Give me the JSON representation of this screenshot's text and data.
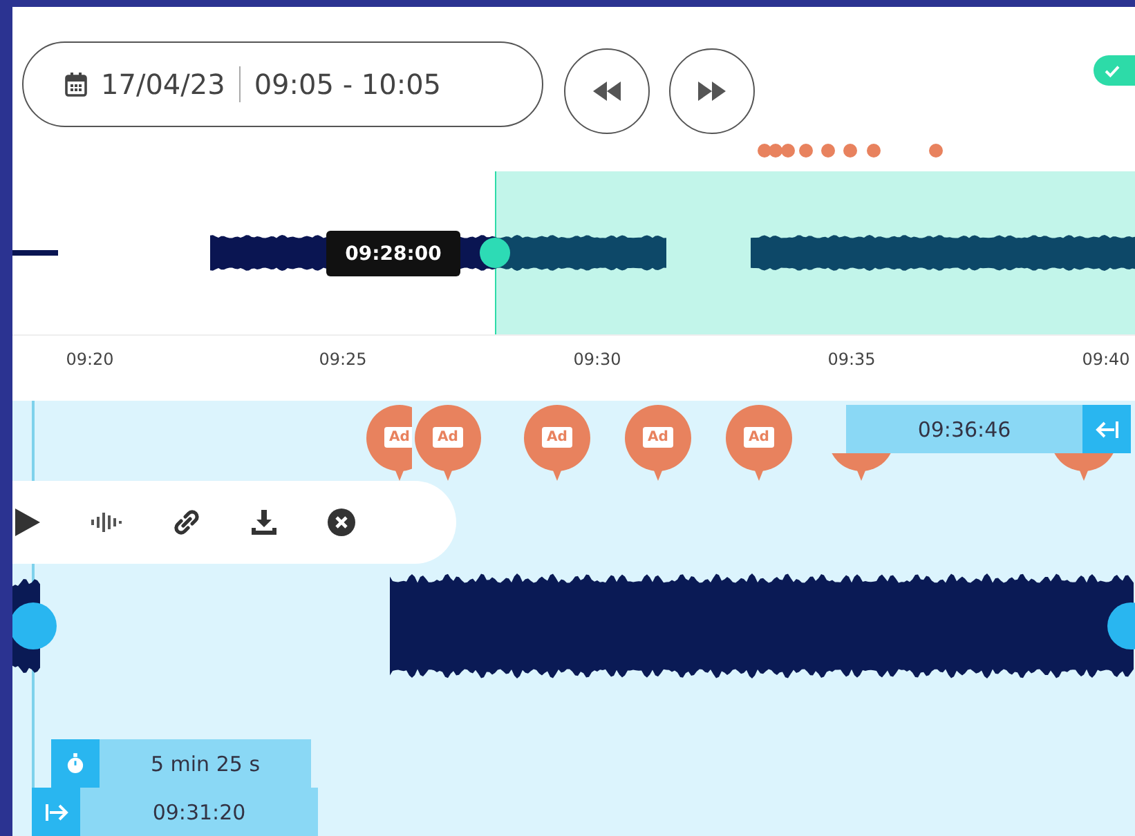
{
  "date_range": {
    "date": "17/04/23",
    "time": "09:05 - 10:05"
  },
  "nav_buttons": [
    {
      "kind": "rewind"
    },
    {
      "kind": "forward"
    }
  ],
  "status_toggle": {
    "on": true
  },
  "overview": {
    "playhead_time": "09:28:00"
  },
  "axis": {
    "ticks": [
      "09:20",
      "09:25",
      "09:30",
      "09:35",
      "09:40"
    ]
  },
  "detail": {
    "ad_markers": [
      {
        "kind": "labeled",
        "label": "Ad"
      },
      {
        "kind": "labeled",
        "label": "Ad"
      },
      {
        "kind": "labeled",
        "label": "Ad"
      },
      {
        "kind": "labeled",
        "label": "Ad"
      },
      {
        "kind": "labeled",
        "label": "Ad"
      },
      {
        "kind": "covered"
      },
      {
        "kind": "covered"
      }
    ],
    "end_time": "09:36:46",
    "toolbar": [
      {
        "kind": "play"
      },
      {
        "kind": "waveform"
      },
      {
        "kind": "link"
      },
      {
        "kind": "download"
      },
      {
        "kind": "close"
      }
    ],
    "duration": "5 min 25 s",
    "start_time": "09:31:20"
  }
}
